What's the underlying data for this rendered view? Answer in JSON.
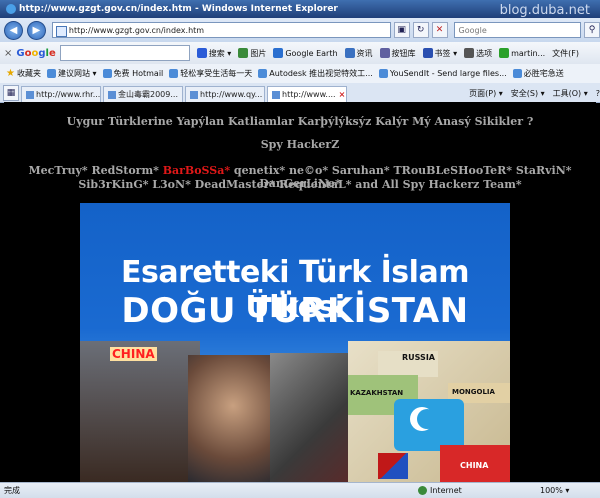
{
  "window": {
    "title": "http://www.gzgt.gov.cn/index.htm - Windows Internet Explorer",
    "watermark": "blog.duba.net"
  },
  "nav": {
    "back": "◀",
    "forward": "▶",
    "address": "http://www.gzgt.gov.cn/index.htm",
    "search_placeholder": "Google"
  },
  "google_toolbar": {
    "close": "×",
    "logo": [
      "G",
      "o",
      "o",
      "g",
      "l",
      "e"
    ],
    "items": [
      {
        "label": "搜索 ▾",
        "icon": "search-icon",
        "color": "#2a5bd7"
      },
      {
        "label": "图片",
        "icon": "image-icon",
        "color": "#3a8a3a"
      },
      {
        "label": "Google Earth",
        "icon": "globe-icon",
        "color": "#2a6fd0"
      },
      {
        "label": "资讯",
        "icon": "news-icon",
        "color": "#3a70c0"
      },
      {
        "label": "按钮库",
        "icon": "button-gallery-icon",
        "color": "#6060a0"
      },
      {
        "label": "书签 ▾",
        "icon": "star-icon",
        "color": "#2a4fb0"
      },
      {
        "label": "选项",
        "icon": "wrench-icon",
        "color": "#555555"
      },
      {
        "label": "martin...",
        "icon": "user-icon",
        "color": "#2aa02a"
      },
      {
        "label": "文件(F)",
        "icon": "",
        "color": ""
      }
    ]
  },
  "favorites": {
    "label": "收藏夹",
    "items": [
      {
        "label": "建议网站 ▾"
      },
      {
        "label": "免费 Hotmail"
      },
      {
        "label": "轻松享受生活每一天"
      },
      {
        "label": "Autodesk 推出视觉特效工..."
      },
      {
        "label": "YouSendIt - Send large files..."
      },
      {
        "label": "必胜宅急送"
      }
    ]
  },
  "tabs": {
    "items": [
      {
        "label": "http://www.rhr...",
        "active": false
      },
      {
        "label": "金山毒霸2009...",
        "active": false
      },
      {
        "label": "http://www.qy...",
        "active": false
      },
      {
        "label": "http://www....",
        "active": true
      }
    ],
    "close": "×",
    "tools": [
      "页面(P) ▾",
      "安全(S) ▾",
      "工具(O) ▾",
      "?"
    ]
  },
  "page": {
    "line1": "Uygur Türklerine Yapýlan Katliamlar Karþýlýksýz Kalýr Mý Anasý Sikikler ?",
    "line2": "Spy HackerZ",
    "line3_pre": "MecTruy* RedStorm* ",
    "line3_red": "BarBoSSa*",
    "line3_post": " qenetix* ne©o* Saruhan* TRouBLeSHooTeR* StaRviN* DanGerLiNe*",
    "line4": "Sib3rKinG* L3oN* DeadMaster* RequentaL* and All Spy Hackerz Team*",
    "banner_line1": "Esaretteki Türk İslam Ülkesi",
    "banner_line2": "DOĞU TÜRKİSTAN",
    "badge": "CHINA",
    "map_labels": {
      "russia": "RUSSIA",
      "kazakhstan": "KAZAKHSTAN",
      "mongolia": "MONGOLIA",
      "china": "CHINA"
    }
  },
  "status": {
    "text": "完成",
    "zone": "Internet",
    "zoom": "100% ▾"
  }
}
